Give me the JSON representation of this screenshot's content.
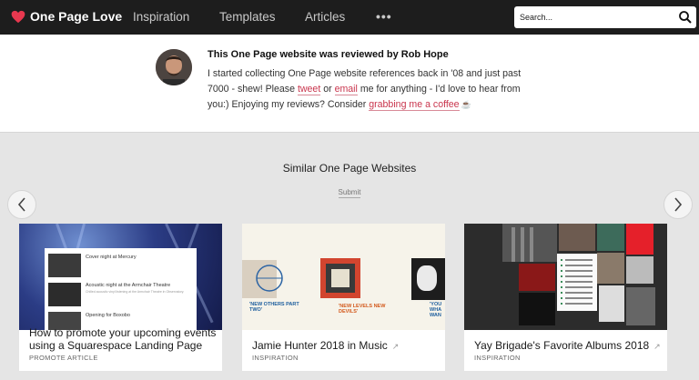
{
  "header": {
    "logo_text": "One Page Love",
    "nav": [
      "Inspiration",
      "Templates",
      "Articles"
    ],
    "more": "•••",
    "search_placeholder": "Search..."
  },
  "review": {
    "title": "This One Page website was reviewed by Rob Hope",
    "line1": "I started collecting One Page website references back in '08 and just past 7000 - shew! Please ",
    "tweet": "tweet",
    "or": " or ",
    "email": "email",
    "line2": " me for anything - I'd love to hear from you:) Enjoying my reviews? Consider ",
    "coffee": "grabbing me a coffee",
    "cup": "☕"
  },
  "similar": {
    "title": "Similar One Page Websites",
    "submit": "Submit"
  },
  "cards": [
    {
      "title": "How to promote your upcoming events using a Squarespace Landing Page",
      "tag": "PROMOTE ARTICLE",
      "thumb_rows": [
        "Cover night at Mercury",
        "Acoustic night at the Armchair Theatre",
        "Opening for Boxobo"
      ],
      "thumb_sub": "Chilled acoustic vinyl listening at the Armchair Theatre in Observatory."
    },
    {
      "title": "Jamie Hunter 2018 in Music",
      "tag": "INSPIRATION",
      "ext": "↗",
      "thumb_captions": [
        "'NEW OTHERS PART TWO'",
        "'NEW LEVELS NEW DEVILS'",
        "'YOU WHA WAN"
      ]
    },
    {
      "title": "Yay Brigade's Favorite Albums 2018",
      "tag": "INSPIRATION",
      "ext": "↗"
    }
  ],
  "colors": {
    "accent": "#c9354d",
    "topbar": "#1d1d1d",
    "background": "#e5e5e5"
  }
}
